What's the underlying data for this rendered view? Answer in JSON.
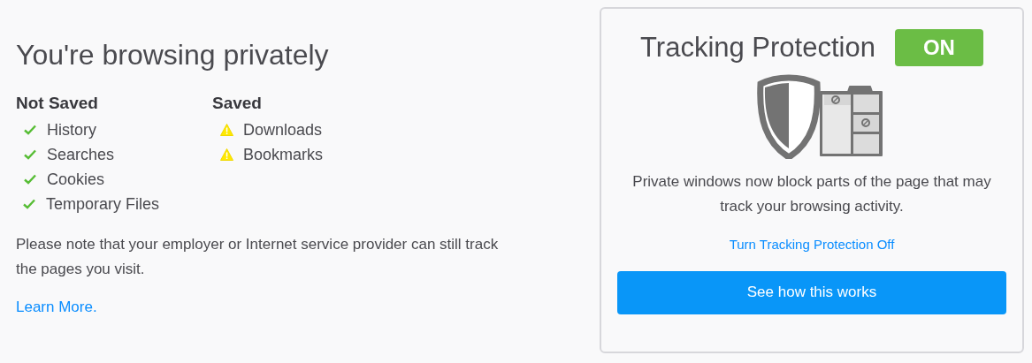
{
  "title": "You're browsing privately",
  "lists": [
    {
      "heading": "Not Saved",
      "kind": "check",
      "items": [
        "History",
        "Searches",
        "Cookies",
        "Temporary Files"
      ]
    },
    {
      "heading": "Saved",
      "kind": "warning",
      "items": [
        "Downloads",
        "Bookmarks"
      ]
    }
  ],
  "note": "Please note that your employer or Internet service provider can still track the pages you visit.",
  "learn_more": "Learn More.",
  "tracking": {
    "title": "Tracking Protection",
    "badge": "ON",
    "on": true,
    "description": "Private windows now block parts of the page that may track your browsing activity.",
    "toggle_link": "Turn Tracking Protection Off",
    "button": "See how this works"
  }
}
